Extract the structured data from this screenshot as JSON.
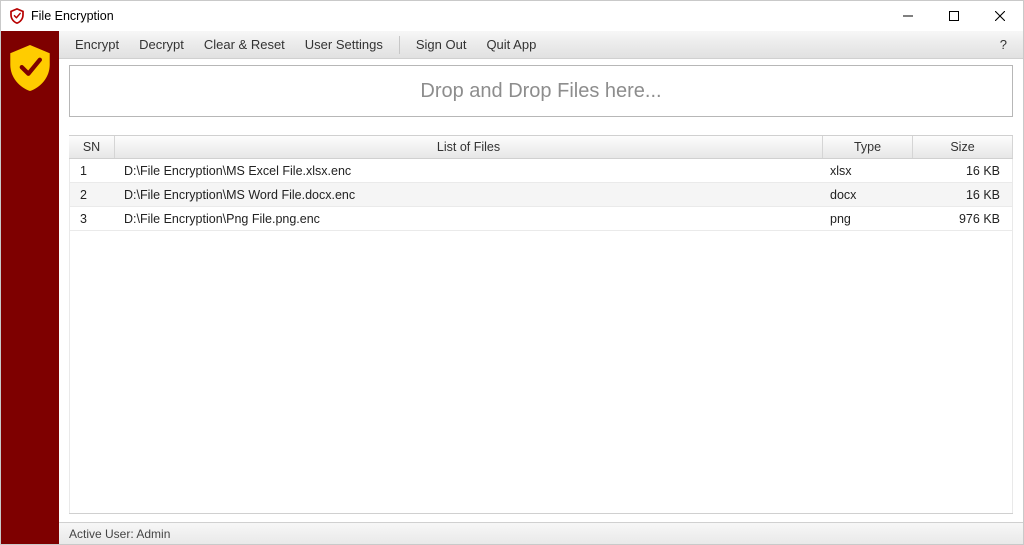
{
  "colors": {
    "sidebar": "#7e0000",
    "shield_fill": "#ffcc00",
    "shield_check": "#7e0000",
    "titlebar_icon_primary": "#b70000",
    "titlebar_icon_inner": "#ffffff",
    "titlebar_icon_check": "#b70000"
  },
  "title": "File Encryption",
  "menubar": {
    "items_left": [
      "Encrypt",
      "Decrypt",
      "Clear & Reset",
      "User Settings"
    ],
    "items_right": [
      "Sign Out",
      "Quit App"
    ],
    "help": "?"
  },
  "dropzone": {
    "text": "Drop and Drop Files here..."
  },
  "table": {
    "columns": {
      "sn": "SN",
      "file": "List of Files",
      "type": "Type",
      "size": "Size"
    },
    "rows": [
      {
        "sn": "1",
        "file": "D:\\File Encryption\\MS Excel File.xlsx.enc",
        "type": "xlsx",
        "size": "16 KB"
      },
      {
        "sn": "2",
        "file": "D:\\File Encryption\\MS Word File.docx.enc",
        "type": "docx",
        "size": "16 KB"
      },
      {
        "sn": "3",
        "file": "D:\\File Encryption\\Png File.png.enc",
        "type": "png",
        "size": "976 KB"
      }
    ]
  },
  "status": {
    "text": "Active User: Admin"
  }
}
